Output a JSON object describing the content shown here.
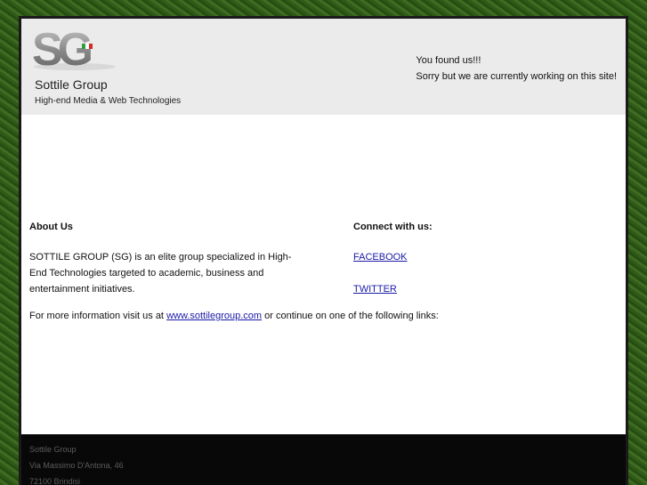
{
  "header": {
    "logo_text": "SG",
    "brand_name": "Sottile Group",
    "tagline": "High-end Media & Web Technologies",
    "notice_line1": "You found us!!!",
    "notice_line2": "Sorry but we are currently working on this site!",
    "flag_colors": [
      "#2e9e3e",
      "#ffffff",
      "#d42a2a"
    ]
  },
  "about": {
    "heading": "About Us",
    "text": "SOTTILE GROUP (SG) is an elite group specialized in High-End Technologies targeted to academic, business and entertainment initiatives."
  },
  "connect": {
    "heading": "Connect with us:",
    "links": [
      {
        "label": "FACEBOOK"
      },
      {
        "label": "TWITTER"
      }
    ]
  },
  "more_info": {
    "prefix": "For more information visit us at ",
    "link": "www.sottilegroup.com",
    "suffix": " or continue on one of the following links:"
  },
  "footer": {
    "line1": "Sottile Group",
    "line2": "Via Massimo D'Antona, 46",
    "line3": "72100 Brindisi"
  },
  "colors": {
    "header_bg": "#ebebeb",
    "content_bg": "#ffffff",
    "footer_bg": "#080808",
    "link": "#1a1aa8"
  }
}
